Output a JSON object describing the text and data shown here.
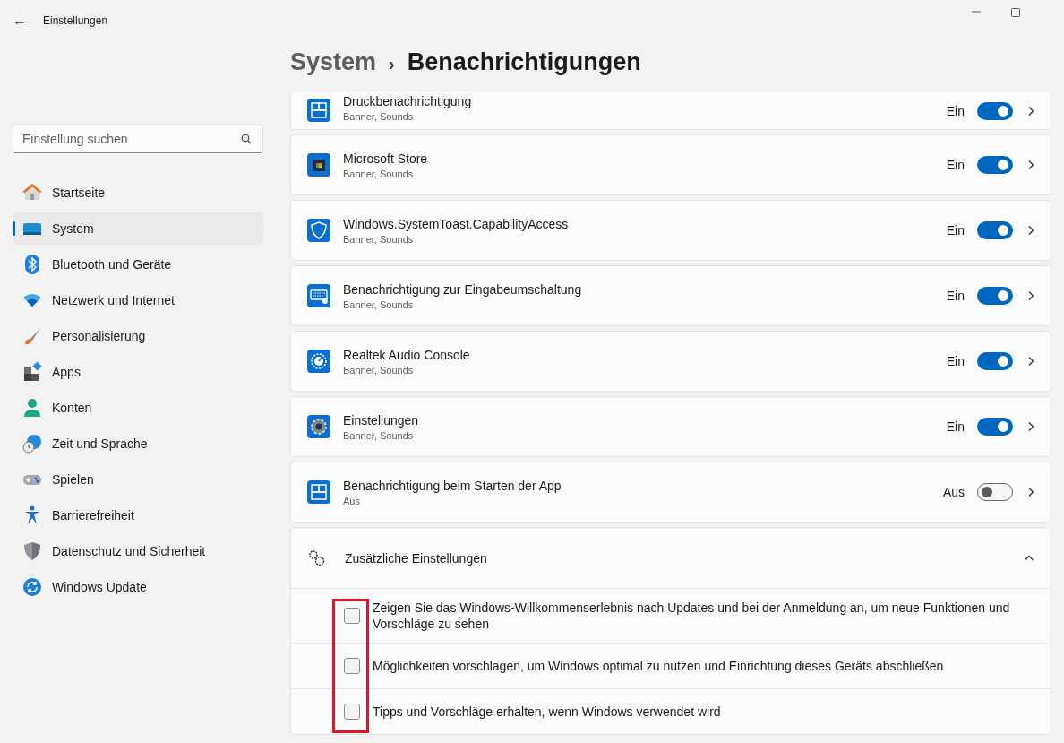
{
  "window": {
    "title": "Einstellungen",
    "back_symbol": "←"
  },
  "search": {
    "placeholder": "Einstellung suchen"
  },
  "sidebar": {
    "items": [
      {
        "label": "Startseite",
        "selected": false
      },
      {
        "label": "System",
        "selected": true
      },
      {
        "label": "Bluetooth und Geräte",
        "selected": false
      },
      {
        "label": "Netzwerk und Internet",
        "selected": false
      },
      {
        "label": "Personalisierung",
        "selected": false
      },
      {
        "label": "Apps",
        "selected": false
      },
      {
        "label": "Konten",
        "selected": false
      },
      {
        "label": "Zeit und Sprache",
        "selected": false
      },
      {
        "label": "Spielen",
        "selected": false
      },
      {
        "label": "Barrierefreiheit",
        "selected": false
      },
      {
        "label": "Datenschutz und Sicherheit",
        "selected": false
      },
      {
        "label": "Windows Update",
        "selected": false
      }
    ]
  },
  "breadcrumb": {
    "parent": "System",
    "separator": "›",
    "current": "Benachrichtigungen"
  },
  "apps": [
    {
      "name": "Druckbenachrichtigung",
      "detail": "Banner, Sounds",
      "state_label": "Ein",
      "on": true
    },
    {
      "name": "Microsoft Store",
      "detail": "Banner, Sounds",
      "state_label": "Ein",
      "on": true
    },
    {
      "name": "Windows.SystemToast.CapabilityAccess",
      "detail": "Banner, Sounds",
      "state_label": "Ein",
      "on": true
    },
    {
      "name": "Benachrichtigung zur Eingabeumschaltung",
      "detail": "Banner, Sounds",
      "state_label": "Ein",
      "on": true
    },
    {
      "name": "Realtek Audio Console",
      "detail": "Banner, Sounds",
      "state_label": "Ein",
      "on": true
    },
    {
      "name": "Einstellungen",
      "detail": "Banner, Sounds",
      "state_label": "Ein",
      "on": true
    },
    {
      "name": "Benachrichtigung beim Starten der App",
      "detail": "Aus",
      "state_label": "Aus",
      "on": false
    }
  ],
  "additional": {
    "title": "Zusätzliche Einstellungen",
    "expanded": true,
    "options": [
      {
        "label": "Zeigen Sie das Windows-Willkommenserlebnis nach Updates und bei der Anmeldung an, um neue Funktionen und Vorschläge zu sehen",
        "checked": false
      },
      {
        "label": "Möglichkeiten vorschlagen, um Windows optimal zu nutzen und Einrichtung dieses Geräts abschließen",
        "checked": false
      },
      {
        "label": "Tipps und Vorschläge erhalten, wenn Windows verwendet wird",
        "checked": false
      }
    ]
  },
  "annotations": [
    {
      "kind": "rectangle",
      "color": "#e81123"
    }
  ]
}
